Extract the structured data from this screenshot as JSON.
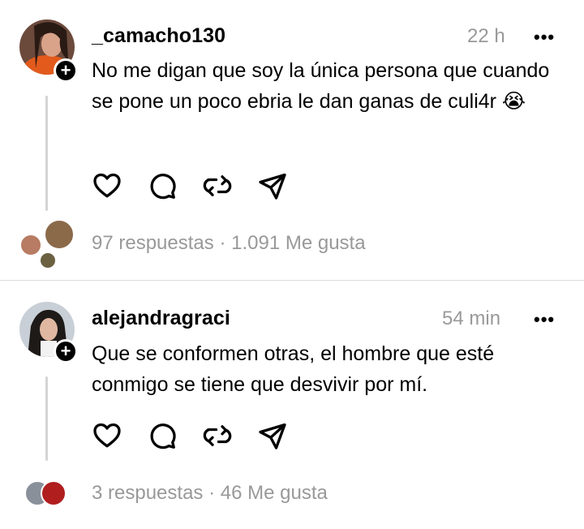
{
  "posts": [
    {
      "username": "_camacho130",
      "time": "22 h",
      "more": "•••",
      "text": "No me digan que soy la única persona que cuando se pone un poco ebria le dan ganas de culi4r 😭",
      "replies": "97 respuestas",
      "separator": "·",
      "likes": "1.091 Me gusta",
      "follow_symbol": "+"
    },
    {
      "username": "alejandragraci",
      "time": "54 min",
      "more": "•••",
      "text": "Que se conformen otras, el hombre que esté conmigo se tiene que desvivir por mí.",
      "replies": "3 respuestas",
      "separator": "·",
      "likes": "46 Me gusta",
      "follow_symbol": "+"
    }
  ],
  "icons": [
    "heart-icon",
    "comment-icon",
    "repost-icon",
    "share-icon"
  ],
  "colors": {
    "muted": "#999999",
    "divider": "#dbdbdb",
    "thread": "#d4d4d4"
  }
}
